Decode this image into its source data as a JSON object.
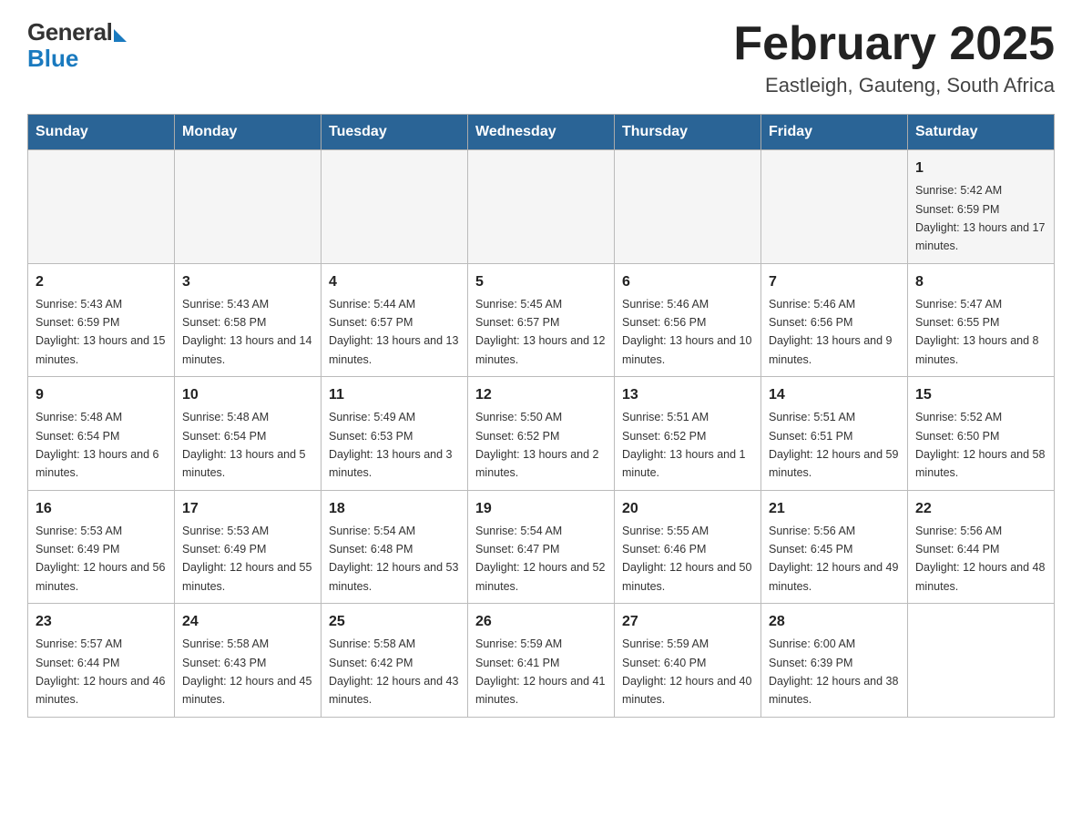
{
  "logo": {
    "general": "General",
    "blue": "Blue"
  },
  "title": "February 2025",
  "location": "Eastleigh, Gauteng, South Africa",
  "days_of_week": [
    "Sunday",
    "Monday",
    "Tuesday",
    "Wednesday",
    "Thursday",
    "Friday",
    "Saturday"
  ],
  "weeks": [
    [
      {
        "day": "",
        "info": ""
      },
      {
        "day": "",
        "info": ""
      },
      {
        "day": "",
        "info": ""
      },
      {
        "day": "",
        "info": ""
      },
      {
        "day": "",
        "info": ""
      },
      {
        "day": "",
        "info": ""
      },
      {
        "day": "1",
        "info": "Sunrise: 5:42 AM\nSunset: 6:59 PM\nDaylight: 13 hours and 17 minutes."
      }
    ],
    [
      {
        "day": "2",
        "info": "Sunrise: 5:43 AM\nSunset: 6:59 PM\nDaylight: 13 hours and 15 minutes."
      },
      {
        "day": "3",
        "info": "Sunrise: 5:43 AM\nSunset: 6:58 PM\nDaylight: 13 hours and 14 minutes."
      },
      {
        "day": "4",
        "info": "Sunrise: 5:44 AM\nSunset: 6:57 PM\nDaylight: 13 hours and 13 minutes."
      },
      {
        "day": "5",
        "info": "Sunrise: 5:45 AM\nSunset: 6:57 PM\nDaylight: 13 hours and 12 minutes."
      },
      {
        "day": "6",
        "info": "Sunrise: 5:46 AM\nSunset: 6:56 PM\nDaylight: 13 hours and 10 minutes."
      },
      {
        "day": "7",
        "info": "Sunrise: 5:46 AM\nSunset: 6:56 PM\nDaylight: 13 hours and 9 minutes."
      },
      {
        "day": "8",
        "info": "Sunrise: 5:47 AM\nSunset: 6:55 PM\nDaylight: 13 hours and 8 minutes."
      }
    ],
    [
      {
        "day": "9",
        "info": "Sunrise: 5:48 AM\nSunset: 6:54 PM\nDaylight: 13 hours and 6 minutes."
      },
      {
        "day": "10",
        "info": "Sunrise: 5:48 AM\nSunset: 6:54 PM\nDaylight: 13 hours and 5 minutes."
      },
      {
        "day": "11",
        "info": "Sunrise: 5:49 AM\nSunset: 6:53 PM\nDaylight: 13 hours and 3 minutes."
      },
      {
        "day": "12",
        "info": "Sunrise: 5:50 AM\nSunset: 6:52 PM\nDaylight: 13 hours and 2 minutes."
      },
      {
        "day": "13",
        "info": "Sunrise: 5:51 AM\nSunset: 6:52 PM\nDaylight: 13 hours and 1 minute."
      },
      {
        "day": "14",
        "info": "Sunrise: 5:51 AM\nSunset: 6:51 PM\nDaylight: 12 hours and 59 minutes."
      },
      {
        "day": "15",
        "info": "Sunrise: 5:52 AM\nSunset: 6:50 PM\nDaylight: 12 hours and 58 minutes."
      }
    ],
    [
      {
        "day": "16",
        "info": "Sunrise: 5:53 AM\nSunset: 6:49 PM\nDaylight: 12 hours and 56 minutes."
      },
      {
        "day": "17",
        "info": "Sunrise: 5:53 AM\nSunset: 6:49 PM\nDaylight: 12 hours and 55 minutes."
      },
      {
        "day": "18",
        "info": "Sunrise: 5:54 AM\nSunset: 6:48 PM\nDaylight: 12 hours and 53 minutes."
      },
      {
        "day": "19",
        "info": "Sunrise: 5:54 AM\nSunset: 6:47 PM\nDaylight: 12 hours and 52 minutes."
      },
      {
        "day": "20",
        "info": "Sunrise: 5:55 AM\nSunset: 6:46 PM\nDaylight: 12 hours and 50 minutes."
      },
      {
        "day": "21",
        "info": "Sunrise: 5:56 AM\nSunset: 6:45 PM\nDaylight: 12 hours and 49 minutes."
      },
      {
        "day": "22",
        "info": "Sunrise: 5:56 AM\nSunset: 6:44 PM\nDaylight: 12 hours and 48 minutes."
      }
    ],
    [
      {
        "day": "23",
        "info": "Sunrise: 5:57 AM\nSunset: 6:44 PM\nDaylight: 12 hours and 46 minutes."
      },
      {
        "day": "24",
        "info": "Sunrise: 5:58 AM\nSunset: 6:43 PM\nDaylight: 12 hours and 45 minutes."
      },
      {
        "day": "25",
        "info": "Sunrise: 5:58 AM\nSunset: 6:42 PM\nDaylight: 12 hours and 43 minutes."
      },
      {
        "day": "26",
        "info": "Sunrise: 5:59 AM\nSunset: 6:41 PM\nDaylight: 12 hours and 41 minutes."
      },
      {
        "day": "27",
        "info": "Sunrise: 5:59 AM\nSunset: 6:40 PM\nDaylight: 12 hours and 40 minutes."
      },
      {
        "day": "28",
        "info": "Sunrise: 6:00 AM\nSunset: 6:39 PM\nDaylight: 12 hours and 38 minutes."
      },
      {
        "day": "",
        "info": ""
      }
    ]
  ]
}
